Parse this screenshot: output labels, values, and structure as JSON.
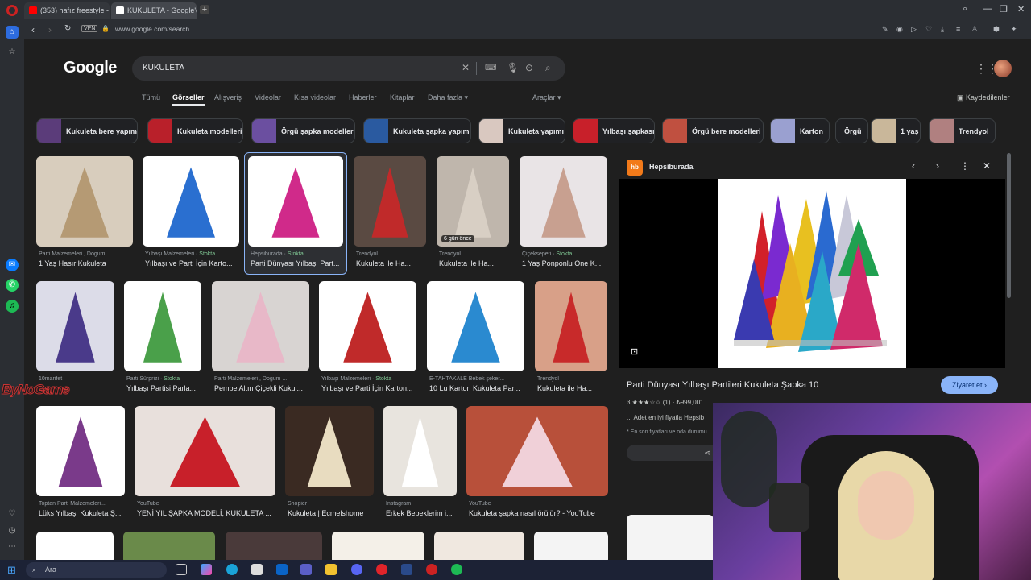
{
  "browser": {
    "tabs": [
      {
        "label": "(353) hafız freestyle - You",
        "icon_color": "#ff0000"
      },
      {
        "label": "KUKULETA - Google'da Ar",
        "icon_color": "#ffffff"
      }
    ],
    "new_tab": "+",
    "url": "www.google.com/search",
    "vpn_label": "VPN"
  },
  "google": {
    "logo": "Google",
    "query": "KUKULETA",
    "nav_tabs": [
      "Tümü",
      "Görseller",
      "Alışveriş",
      "Videolar",
      "Kısa videolar",
      "Haberler",
      "Kitaplar",
      "Daha fazla"
    ],
    "active_tab": "Görseller",
    "tools": "Araçlar",
    "saved": "Kaydedilenler"
  },
  "chips": [
    {
      "label": "Kukuleta bere yapımı",
      "color": "#5b3c7a"
    },
    {
      "label": "Kukuleta modelleri",
      "color": "#b9202a"
    },
    {
      "label": "Örgü şapka modelleri",
      "color": "#6b4fa0"
    },
    {
      "label": "Kukuleta şapka yapımı",
      "color": "#2a5aa0"
    },
    {
      "label": "Kukuleta yapımı",
      "color": "#d9c8c0"
    },
    {
      "label": "Yılbaşı şapkası",
      "color": "#c8202a"
    },
    {
      "label": "Örgü bere modelleri",
      "color": "#c05040"
    },
    {
      "label": "Karton",
      "color": "#9aa0d0"
    },
    {
      "label": "Örgü",
      "color": ""
    },
    {
      "label": "1 yaş",
      "color": "#c9b79a"
    },
    {
      "label": "Trendyol",
      "color": "#b08080"
    }
  ],
  "results_row1": [
    {
      "source": "Parti Malzemeleri , Dogum ...",
      "title": "1 Yaş Hasır Kukuleta",
      "stock": "",
      "badge": "",
      "bg": "#d8cdbd",
      "fg": "#b59a74"
    },
    {
      "source": "Yılbaşı Malzemeleri · ",
      "title": "Yılbaşı ve Parti İçin Karto...",
      "stock": "Stokta",
      "badge": "",
      "bg": "#ffffff",
      "fg": "#2a6fd0"
    },
    {
      "source": "Hepsiburada · ",
      "title": "Parti Dünyası Yılbaşı Part...",
      "stock": "Stokta",
      "badge": "",
      "bg": "#ffffff",
      "fg": "#d02a8a"
    },
    {
      "source": "Trendyol",
      "title": "Kukuleta ile Ha...",
      "stock": "",
      "badge": "",
      "bg": "#5a4a42",
      "fg": "#c02a2a"
    },
    {
      "source": "Trendyol",
      "title": "Kukuleta ile Ha...",
      "stock": "",
      "badge": "6 gün önce",
      "bg": "#bfb6ac",
      "fg": "#d8cfc4"
    },
    {
      "source": "Çiçeksepeti · ",
      "title": "1 Yaş Ponponlu One K...",
      "stock": "Stokta",
      "badge": "",
      "bg": "#e9e4e6",
      "fg": "#c8a090"
    }
  ],
  "results_row2": [
    {
      "source": "10marifet",
      "title": "",
      "stock": "",
      "bg": "#dcdce8",
      "fg": "#4a3a8a"
    },
    {
      "source": "Parti Sürprizi · ",
      "title": "Yılbaşı Partisi Parla...",
      "stock": "Stokta",
      "bg": "#ffffff",
      "fg": "#4aa04a"
    },
    {
      "source": "Parti Malzemeleri , Dogum ...",
      "title": "Pembe Altın Çiçekli Kukul...",
      "stock": "",
      "bg": "#d8d4d2",
      "fg": "#e8b8c8"
    },
    {
      "source": "Yılbaşı Malzemeleri · ",
      "title": "Yılbaşı ve Parti İçin Karton...",
      "stock": "Stokta",
      "bg": "#ffffff",
      "fg": "#c02a2a"
    },
    {
      "source": "E-TAHTAKALE Bebek şeker...",
      "title": "10 Lu Karton Kukuleta Par...",
      "stock": "",
      "bg": "#ffffff",
      "fg": "#2a8ad0"
    },
    {
      "source": "Trendyol",
      "title": "Kukuleta ile Ha...",
      "stock": "",
      "bg": "#d8a088",
      "fg": "#c82a2a"
    }
  ],
  "results_row3": [
    {
      "source": "Toptan Parti Malzemeleri...",
      "title": "Lüks Yılbaşı Kukuleta Ş...",
      "bg": "#ffffff",
      "fg": "#7a3a8a"
    },
    {
      "source": "YouTube",
      "title": "YENİ YIL ŞAPKA MODELİ, KUKULETA ...",
      "bg": "#e8e0dc",
      "fg": "#c8202a"
    },
    {
      "source": "Shopier",
      "title": "Kukuleta | Ecmelshome",
      "bg": "#3a2a22",
      "fg": "#e8dcc0"
    },
    {
      "source": "Instagram",
      "title": "Erkek Bebeklerim i...",
      "bg": "#e8e4de",
      "fg": "#ffffff"
    },
    {
      "source": "YouTube",
      "title": "Kukuleta şapka nasıl örülür? - YouTube",
      "bg": "#b8503a",
      "fg": "#f0d0d8"
    }
  ],
  "preview": {
    "source": "Hepsiburada",
    "logo_text": "hb",
    "title": "Parti Dünyası Yılbaşı Partileri Kukuleta Şapka 10",
    "visit": "Ziyaret et",
    "rating_text": "3 ★★★☆☆ (1) · ₺999,00'",
    "desc": "... Adet en iyi fiyatla Hepsib",
    "note": "* En son fiyatları ve oda durumu"
  },
  "watermark": "ByNoGame",
  "taskbar": {
    "search_label": "Ara"
  }
}
